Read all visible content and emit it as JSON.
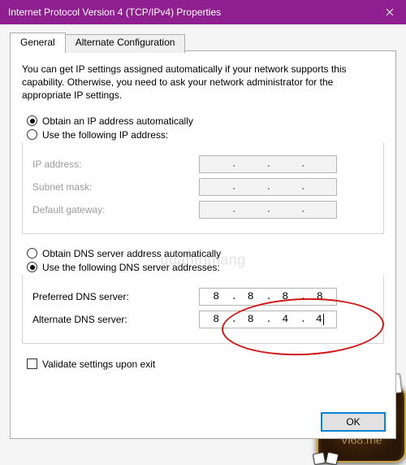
{
  "window": {
    "title": "Internet Protocol Version 4 (TCP/IPv4) Properties"
  },
  "tabs": {
    "general": "General",
    "alternate": "Alternate Configuration"
  },
  "description": "You can get IP settings assigned automatically if your network supports this capability. Otherwise, you need to ask your network administrator for the appropriate IP settings.",
  "ip_section": {
    "auto_label": "Obtain an IP address automatically",
    "manual_label": "Use the following IP address:",
    "selected": "auto",
    "fields": {
      "ip_address_label": "IP address:",
      "subnet_label": "Subnet mask:",
      "gateway_label": "Default gateway:",
      "ip_address": [
        "",
        "",
        "",
        ""
      ],
      "subnet": [
        "",
        "",
        "",
        ""
      ],
      "gateway": [
        "",
        "",
        "",
        ""
      ]
    }
  },
  "dns_section": {
    "auto_label": "Obtain DNS server address automatically",
    "manual_label": "Use the following DNS server addresses:",
    "selected": "manual",
    "fields": {
      "preferred_label": "Preferred DNS server:",
      "alternate_label": "Alternate DNS server:",
      "preferred": [
        "8",
        "8",
        "8",
        "8"
      ],
      "alternate": [
        "8",
        "8",
        "4",
        "4"
      ]
    }
  },
  "validate_label": "Validate settings upon exit",
  "validate_checked": false,
  "buttons": {
    "ok": "OK"
  },
  "watermark_center": "quantrimang",
  "logo": {
    "brand": "Vi68",
    "url": "Vi68.me"
  }
}
